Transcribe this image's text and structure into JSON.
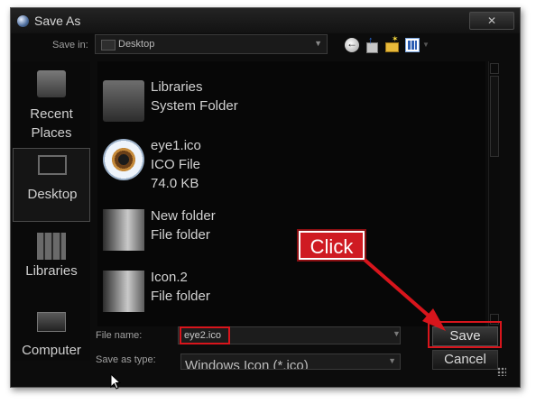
{
  "window": {
    "title": "Save As",
    "close_label": "✕"
  },
  "save_in": {
    "label": "Save in:",
    "value": "Desktop"
  },
  "toolbar": {
    "back": "back-icon",
    "up": "up-folder-icon",
    "new_folder": "new-folder-icon",
    "views": "views-icon"
  },
  "places": [
    {
      "label": "Recent Places"
    },
    {
      "label": "Desktop"
    },
    {
      "label": "Libraries"
    },
    {
      "label": "Computer"
    }
  ],
  "files": [
    {
      "name": "Libraries",
      "type": "System Folder"
    },
    {
      "name": "eye1.ico",
      "type": "ICO File",
      "size": "74.0 KB"
    },
    {
      "name": "New folder",
      "type": "File folder"
    },
    {
      "name": "Icon.2",
      "type": "File folder"
    }
  ],
  "file_name": {
    "label": "File name:",
    "value": "eye2.ico"
  },
  "save_as_type": {
    "label": "Save as type:",
    "value": "Windows Icon (*.ico)"
  },
  "buttons": {
    "save": "Save",
    "cancel": "Cancel"
  },
  "annotation": {
    "callout": "Click"
  },
  "colors": {
    "highlight": "#d8151c",
    "callout_bg": "#cf1b22",
    "window_bg": "#0c0c0c"
  }
}
